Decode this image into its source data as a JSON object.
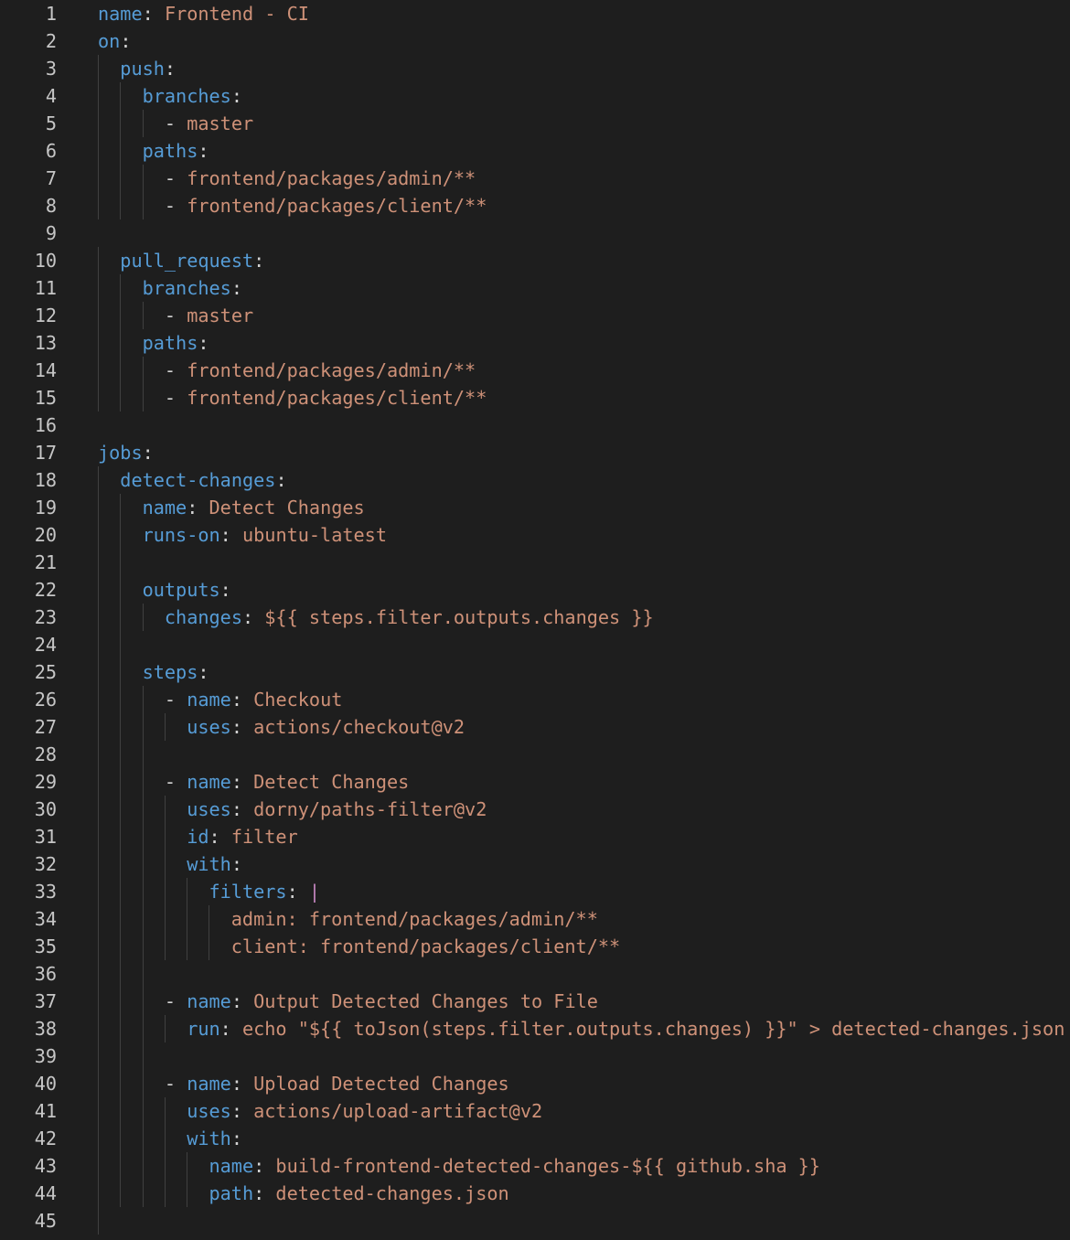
{
  "editor": {
    "language": "yaml",
    "colors": {
      "background": "#1e1e1e",
      "key": "#569cd6",
      "string": "#ce9178",
      "punctuation": "#d4d4d4",
      "block_indicator": "#c586c0",
      "line_number": "#c6c6c6",
      "indent_guide": "#404040"
    },
    "lines": [
      {
        "n": "1",
        "indent": 0,
        "tokens": [
          [
            "key",
            "name"
          ],
          [
            "pun",
            ": "
          ],
          [
            "str",
            "Frontend - CI"
          ]
        ]
      },
      {
        "n": "2",
        "indent": 0,
        "tokens": [
          [
            "key",
            "on"
          ],
          [
            "pun",
            ":"
          ]
        ]
      },
      {
        "n": "3",
        "indent": 1,
        "tokens": [
          [
            "key",
            "push"
          ],
          [
            "pun",
            ":"
          ]
        ]
      },
      {
        "n": "4",
        "indent": 2,
        "tokens": [
          [
            "key",
            "branches"
          ],
          [
            "pun",
            ":"
          ]
        ]
      },
      {
        "n": "5",
        "indent": 3,
        "tokens": [
          [
            "pun",
            "- "
          ],
          [
            "str",
            "master"
          ]
        ]
      },
      {
        "n": "6",
        "indent": 2,
        "tokens": [
          [
            "key",
            "paths"
          ],
          [
            "pun",
            ":"
          ]
        ]
      },
      {
        "n": "7",
        "indent": 3,
        "tokens": [
          [
            "pun",
            "- "
          ],
          [
            "str",
            "frontend/packages/admin/**"
          ]
        ]
      },
      {
        "n": "8",
        "indent": 3,
        "tokens": [
          [
            "pun",
            "- "
          ],
          [
            "str",
            "frontend/packages/client/**"
          ]
        ]
      },
      {
        "n": "9",
        "indent": 0,
        "tokens": []
      },
      {
        "n": "10",
        "indent": 1,
        "tokens": [
          [
            "key",
            "pull_request"
          ],
          [
            "pun",
            ":"
          ]
        ]
      },
      {
        "n": "11",
        "indent": 2,
        "tokens": [
          [
            "key",
            "branches"
          ],
          [
            "pun",
            ":"
          ]
        ]
      },
      {
        "n": "12",
        "indent": 3,
        "tokens": [
          [
            "pun",
            "- "
          ],
          [
            "str",
            "master"
          ]
        ]
      },
      {
        "n": "13",
        "indent": 2,
        "tokens": [
          [
            "key",
            "paths"
          ],
          [
            "pun",
            ":"
          ]
        ]
      },
      {
        "n": "14",
        "indent": 3,
        "tokens": [
          [
            "pun",
            "- "
          ],
          [
            "str",
            "frontend/packages/admin/**"
          ]
        ]
      },
      {
        "n": "15",
        "indent": 3,
        "tokens": [
          [
            "pun",
            "- "
          ],
          [
            "str",
            "frontend/packages/client/**"
          ]
        ]
      },
      {
        "n": "16",
        "indent": 0,
        "tokens": []
      },
      {
        "n": "17",
        "indent": 0,
        "tokens": [
          [
            "key",
            "jobs"
          ],
          [
            "pun",
            ":"
          ]
        ]
      },
      {
        "n": "18",
        "indent": 1,
        "tokens": [
          [
            "key",
            "detect-changes"
          ],
          [
            "pun",
            ":"
          ]
        ]
      },
      {
        "n": "19",
        "indent": 2,
        "tokens": [
          [
            "key",
            "name"
          ],
          [
            "pun",
            ": "
          ],
          [
            "str",
            "Detect Changes"
          ]
        ]
      },
      {
        "n": "20",
        "indent": 2,
        "tokens": [
          [
            "key",
            "runs-on"
          ],
          [
            "pun",
            ": "
          ],
          [
            "str",
            "ubuntu-latest"
          ]
        ]
      },
      {
        "n": "21",
        "indent": 2,
        "tokens": []
      },
      {
        "n": "22",
        "indent": 2,
        "tokens": [
          [
            "key",
            "outputs"
          ],
          [
            "pun",
            ":"
          ]
        ]
      },
      {
        "n": "23",
        "indent": 3,
        "tokens": [
          [
            "key",
            "changes"
          ],
          [
            "pun",
            ": "
          ],
          [
            "str",
            "${{ steps.filter.outputs.changes }}"
          ]
        ]
      },
      {
        "n": "24",
        "indent": 2,
        "tokens": []
      },
      {
        "n": "25",
        "indent": 2,
        "tokens": [
          [
            "key",
            "steps"
          ],
          [
            "pun",
            ":"
          ]
        ]
      },
      {
        "n": "26",
        "indent": 3,
        "tokens": [
          [
            "pun",
            "- "
          ],
          [
            "key",
            "name"
          ],
          [
            "pun",
            ": "
          ],
          [
            "str",
            "Checkout"
          ]
        ]
      },
      {
        "n": "27",
        "indent": 4,
        "tokens": [
          [
            "key",
            "uses"
          ],
          [
            "pun",
            ": "
          ],
          [
            "str",
            "actions/checkout@v2"
          ]
        ]
      },
      {
        "n": "28",
        "indent": 3,
        "tokens": []
      },
      {
        "n": "29",
        "indent": 3,
        "tokens": [
          [
            "pun",
            "- "
          ],
          [
            "key",
            "name"
          ],
          [
            "pun",
            ": "
          ],
          [
            "str",
            "Detect Changes"
          ]
        ]
      },
      {
        "n": "30",
        "indent": 4,
        "tokens": [
          [
            "key",
            "uses"
          ],
          [
            "pun",
            ": "
          ],
          [
            "str",
            "dorny/paths-filter@v2"
          ]
        ]
      },
      {
        "n": "31",
        "indent": 4,
        "tokens": [
          [
            "key",
            "id"
          ],
          [
            "pun",
            ": "
          ],
          [
            "str",
            "filter"
          ]
        ]
      },
      {
        "n": "32",
        "indent": 4,
        "tokens": [
          [
            "key",
            "with"
          ],
          [
            "pun",
            ":"
          ]
        ]
      },
      {
        "n": "33",
        "indent": 5,
        "tokens": [
          [
            "key",
            "filters"
          ],
          [
            "pun",
            ": "
          ],
          [
            "pipe",
            "|"
          ]
        ]
      },
      {
        "n": "34",
        "indent": 6,
        "tokens": [
          [
            "str",
            "admin: frontend/packages/admin/**"
          ]
        ]
      },
      {
        "n": "35",
        "indent": 6,
        "tokens": [
          [
            "str",
            "client: frontend/packages/client/**"
          ]
        ]
      },
      {
        "n": "36",
        "indent": 3,
        "tokens": []
      },
      {
        "n": "37",
        "indent": 3,
        "tokens": [
          [
            "pun",
            "- "
          ],
          [
            "key",
            "name"
          ],
          [
            "pun",
            ": "
          ],
          [
            "str",
            "Output Detected Changes to File"
          ]
        ]
      },
      {
        "n": "38",
        "indent": 4,
        "tokens": [
          [
            "key",
            "run"
          ],
          [
            "pun",
            ": "
          ],
          [
            "str",
            "echo \"${{ toJson(steps.filter.outputs.changes) }}\" > detected-changes.json"
          ]
        ]
      },
      {
        "n": "39",
        "indent": 3,
        "tokens": []
      },
      {
        "n": "40",
        "indent": 3,
        "tokens": [
          [
            "pun",
            "- "
          ],
          [
            "key",
            "name"
          ],
          [
            "pun",
            ": "
          ],
          [
            "str",
            "Upload Detected Changes"
          ]
        ]
      },
      {
        "n": "41",
        "indent": 4,
        "tokens": [
          [
            "key",
            "uses"
          ],
          [
            "pun",
            ": "
          ],
          [
            "str",
            "actions/upload-artifact@v2"
          ]
        ]
      },
      {
        "n": "42",
        "indent": 4,
        "tokens": [
          [
            "key",
            "with"
          ],
          [
            "pun",
            ":"
          ]
        ]
      },
      {
        "n": "43",
        "indent": 5,
        "tokens": [
          [
            "key",
            "name"
          ],
          [
            "pun",
            ": "
          ],
          [
            "str",
            "build-frontend-detected-changes-${{ github.sha }}"
          ]
        ]
      },
      {
        "n": "44",
        "indent": 5,
        "tokens": [
          [
            "key",
            "path"
          ],
          [
            "pun",
            ": "
          ],
          [
            "str",
            "detected-changes.json"
          ]
        ]
      },
      {
        "n": "45",
        "indent": 1,
        "tokens": []
      }
    ]
  }
}
